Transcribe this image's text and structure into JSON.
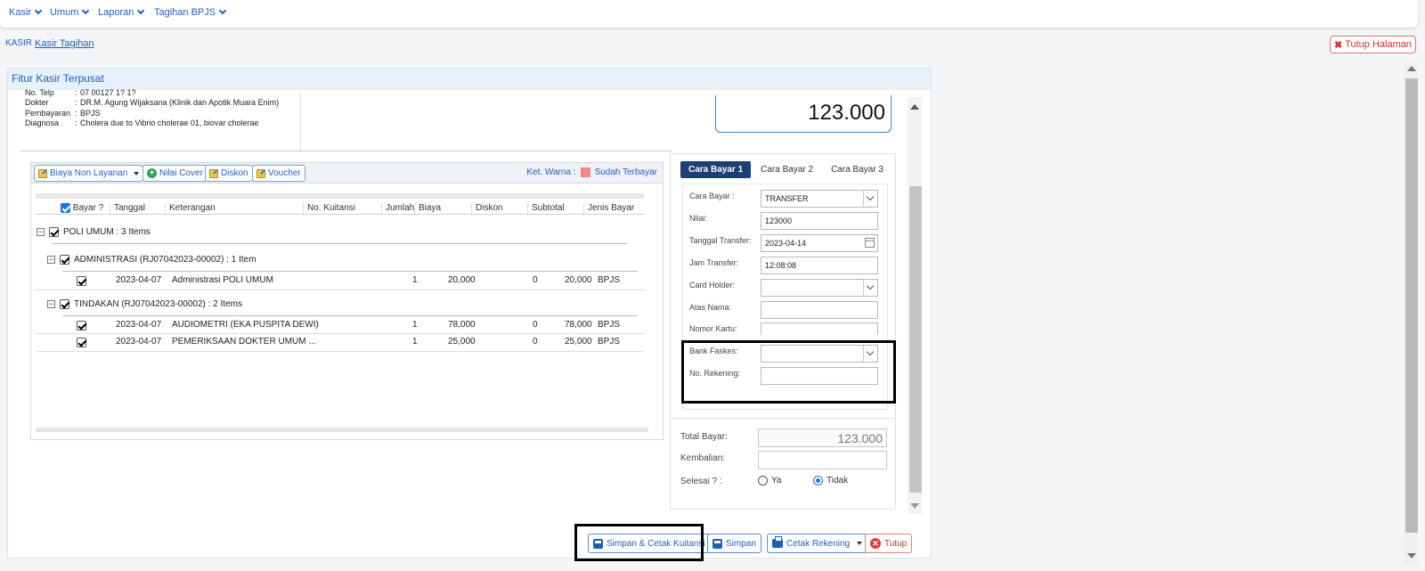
{
  "nav": {
    "menus": [
      "Kasir",
      "Umum",
      "Laporan",
      "Tagihan BPJS"
    ]
  },
  "breadcrumb": {
    "root": "KASIR",
    "current": "Kasir Tagihan"
  },
  "close_page_label": "Tutup Halaman",
  "panel_title": "Fitur Kasir Terpusat",
  "patient": {
    "phone_label": "No. Telp",
    "phone_value": "07 00127 1? 1?",
    "doctor_label": "Dokter",
    "doctor_value": "DR.M. Agung Wijaksana (Klinik dan Apotik Muara Enim)",
    "payment_label": "Pembayaran",
    "payment_value": "BPJS",
    "diagnosis_label": "Diagnosa",
    "diagnosis_value": "Cholera due to Vibrio cholerae 01, biovar cholerae"
  },
  "total_display": "123.000",
  "toolbar": {
    "biaya_non_layanan": "Biaya Non Layanan",
    "nilai_cover": "Nilai Cover",
    "diskon": "Diskon",
    "voucher": "Voucher",
    "legend_label": "Ket. Warna :",
    "legend_paid": "Sudah Terbayar",
    "legend_color": "#ef8a80"
  },
  "columns": [
    "Bayar ?",
    "Tanggal",
    "Keterangan",
    "No. Kuitansi",
    "Jumlah",
    "Biaya",
    "Diskon",
    "Subtotal",
    "Jenis Bayar"
  ],
  "groups": {
    "poli": "POLI UMUM : 3 Items",
    "admin": "ADMINISTRASI (RJ07042023-00002) : 1 Item",
    "tindakan": "TINDAKAN (RJ07042023-00002) : 2 Items"
  },
  "rows": [
    {
      "tanggal": "2023-04-07",
      "keterangan": "Administrasi POLI UMUM",
      "jumlah": "1",
      "biaya": "20,000",
      "diskon": "0",
      "subtotal": "20,000",
      "jenis": "BPJS"
    },
    {
      "tanggal": "2023-04-07",
      "keterangan": "AUDIOMETRI (EKA PUSPITA DEWI)",
      "jumlah": "1",
      "biaya": "78,000",
      "diskon": "0",
      "subtotal": "78,000",
      "jenis": "BPJS"
    },
    {
      "tanggal": "2023-04-07",
      "keterangan": "PEMERIKSAAN DOKTER UMUM ...",
      "jumlah": "1",
      "biaya": "25,000",
      "diskon": "0",
      "subtotal": "25,000",
      "jenis": "BPJS"
    }
  ],
  "payment_tabs": [
    "Cara Bayar 1",
    "Cara Bayar 2",
    "Cara Bayar 3"
  ],
  "form": {
    "cara_bayar_label": "Cara Bayar :",
    "cara_bayar_value": "TRANSFER",
    "nilai_label": "Nilai:",
    "nilai_value": "123000",
    "tgl_transfer_label": "Tanggal Transfer:",
    "tgl_transfer_value": "2023-04-14",
    "jam_transfer_label": "Jam Transfer:",
    "jam_transfer_value": "12:08:08",
    "card_holder_label": "Card Holder:",
    "atas_nama_label": "Atas Nama:",
    "nomor_kartu_label": "Nomor Kartu:",
    "bank_faskes_label": "Bank Faskes:",
    "no_rekening_label": "No. Rekening:"
  },
  "summary": {
    "total_bayar_label": "Total Bayar:",
    "total_bayar_value": "123.000",
    "kembalian_label": "Kembalian:",
    "selesai_label": "Selesai ? :",
    "ya": "Ya",
    "tidak": "Tidak",
    "selesai_selected": "Tidak"
  },
  "buttons": {
    "simpan_cetak": "Simpan & Cetak Kuitansi",
    "simpan": "Simpan",
    "cetak_rekening": "Cetak Rekening",
    "tutup": "Tutup"
  },
  "colors": {
    "accent": "#1f5fbf",
    "active_tab": "#1d3f73"
  }
}
